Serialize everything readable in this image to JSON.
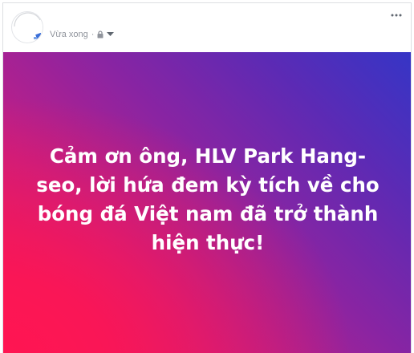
{
  "post": {
    "timestamp": "Vừa xong",
    "separator": "·",
    "privacy_icon": "lock-icon",
    "audience_menu_icon": "caret-down-icon",
    "more_icon": "more-horizontal-icon"
  },
  "banner": {
    "text": "Cảm ơn ông, HLV Park Hang-seo, lời hứa đem kỳ tích về cho bóng đá Việt nam đã trở thành hiện thực!",
    "gradient_colors": [
      "#ff1552",
      "#8a24a2",
      "#3535c6"
    ],
    "text_color": "#ffffff"
  }
}
